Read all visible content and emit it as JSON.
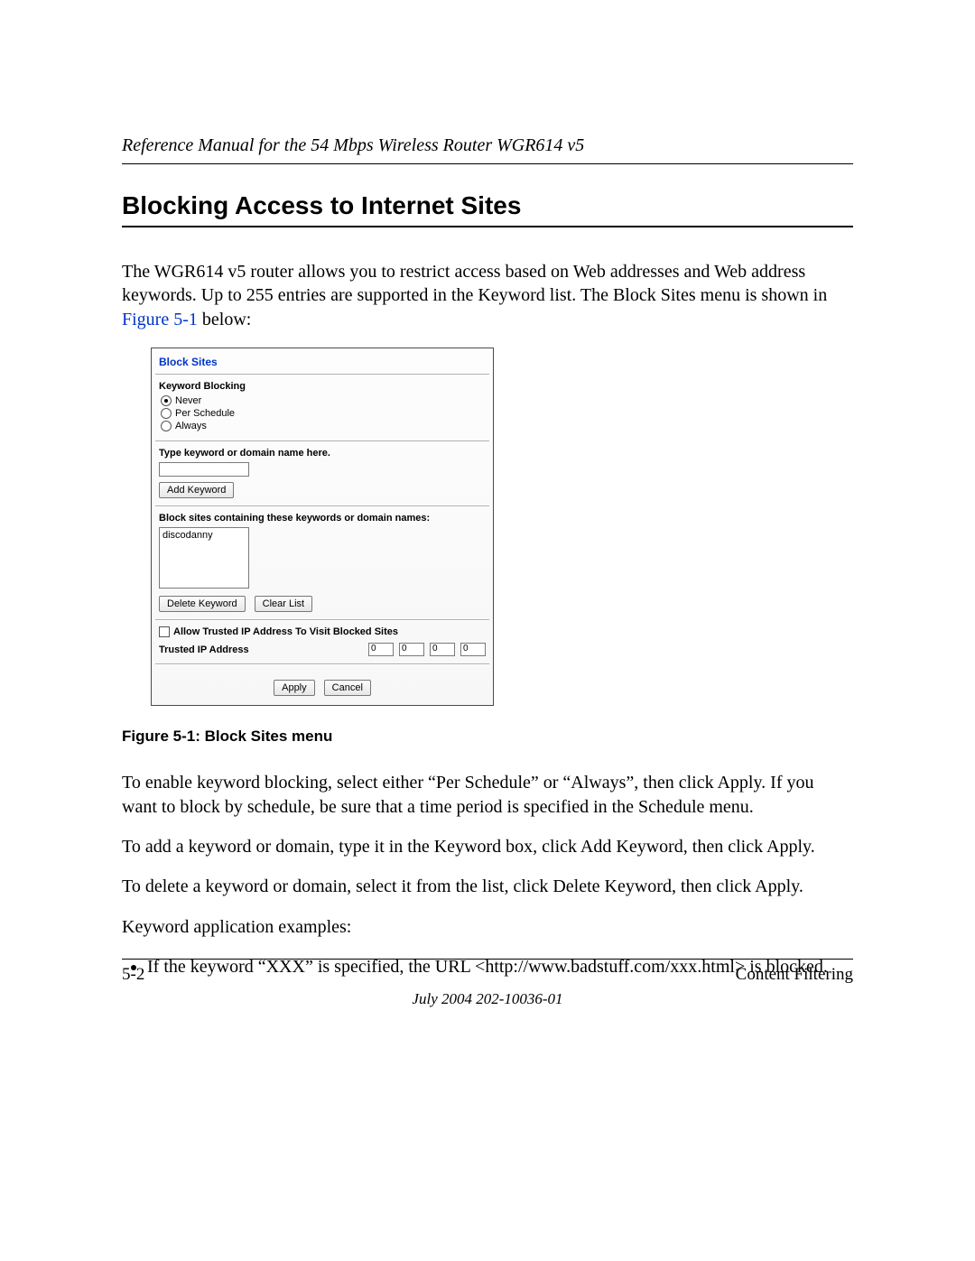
{
  "header": {
    "running": "Reference Manual for the 54 Mbps Wireless Router WGR614 v5"
  },
  "title": "Blocking Access to Internet Sites",
  "intro": {
    "p1a": "The WGR614 v5 router allows you to restrict access based on Web addresses and Web address keywords. Up to 255 entries are supported in the Keyword list. The Block Sites menu is shown in ",
    "figlink": "Figure 5-1",
    "p1b": " below:"
  },
  "screenshot": {
    "title": "Block Sites",
    "keyword_blocking_label": "Keyword Blocking",
    "radios": {
      "never": "Never",
      "per_schedule": "Per Schedule",
      "always": "Always"
    },
    "type_label": "Type keyword or domain name here.",
    "add_keyword_btn": "Add Keyword",
    "list_label": "Block sites containing these keywords or domain names:",
    "list_item": "discodanny",
    "delete_btn": "Delete Keyword",
    "clear_btn": "Clear List",
    "allow_trusted_label": "Allow Trusted IP Address To Visit Blocked Sites",
    "trusted_label": "Trusted IP Address",
    "ip": {
      "a": "0",
      "b": "0",
      "c": "0",
      "d": "0"
    },
    "apply_btn": "Apply",
    "cancel_btn": "Cancel"
  },
  "caption": "Figure 5-1:  Block Sites menu",
  "body": {
    "p2": "To enable keyword blocking, select either “Per Schedule” or “Always”, then click Apply. If you want to block by schedule, be sure that a time period is specified in the Schedule menu.",
    "p3": "To add a keyword or domain, type it in the Keyword box, click Add Keyword, then click Apply.",
    "p4": "To delete a keyword or domain, select it from the list, click Delete Keyword, then click Apply.",
    "p5": "Keyword application examples:",
    "bullet1": "If the keyword “XXX” is specified, the URL <http://www.badstuff.com/xxx.html> is blocked."
  },
  "footer": {
    "page": "5-2",
    "section": "Content Filtering",
    "date": "July 2004 202-10036-01"
  }
}
